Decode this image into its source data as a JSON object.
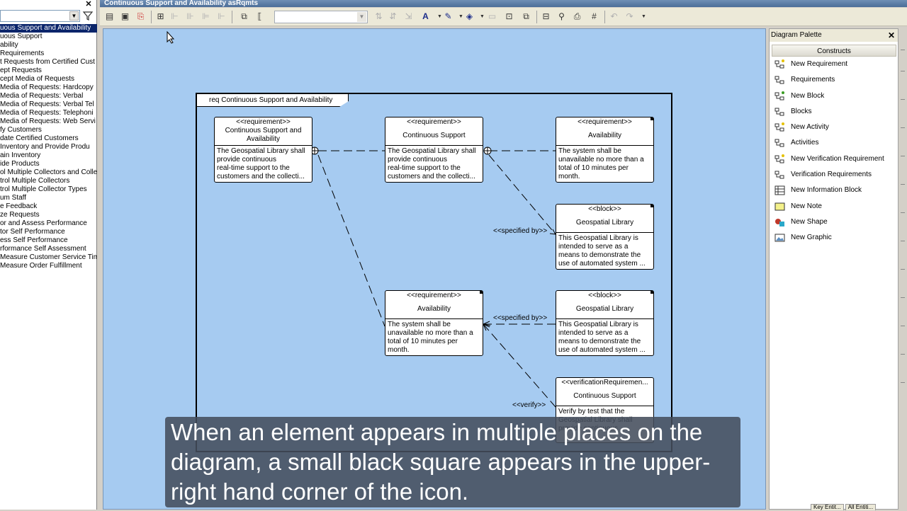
{
  "window": {
    "title": "Continuous Support and Availability asRqmts"
  },
  "tree": {
    "items": [
      "uous Support and Availability",
      "uous Support",
      "ability",
      "Requirements",
      "t Requests from Certified Cust",
      "ept Requests",
      "cept Media of Requests",
      "Media of Requests: Hardcopy",
      "Media of Requests: Verbal",
      "Media of Requests: Verbal Tel",
      "Media of Requests: Telephoni",
      "Media of Requests: Web Servi",
      "fy Customers",
      "date Certified Customers",
      " Inventory and Provide Produ",
      "ain Inventory",
      "ide Products",
      "ol Multiple Collectors and Collec",
      "trol Multiple Collectors",
      "trol Multiple Collector Types",
      "um Staff",
      "e Feedback",
      "ze Requests",
      "or and Assess Performance",
      "tor Self Performance",
      "ess Self Performance",
      "rformance Self Assessment",
      "Measure Customer Service Tim",
      "Measure Order Fulfillment"
    ]
  },
  "diagram": {
    "frame_label": "req Continuous Support and Availability",
    "nodes": {
      "req1": {
        "stereotype": "<<requirement>>",
        "name": "Continuous Support and\nAvailability",
        "text": "The Geospatial Library shall\nprovide continuous\nreal-time support to the\ncustomers and the collecti..."
      },
      "req2": {
        "stereotype": "<<requirement>>",
        "name": "Continuous Support",
        "text": "The Geospatial Library shall\nprovide continuous\nreal-time support to the\ncustomers and the collecti..."
      },
      "req3": {
        "stereotype": "<<requirement>>",
        "name": "Availability",
        "text": "The system shall be\nunavailable no more than a\ntotal of 10 minutes per\nmonth."
      },
      "block1": {
        "stereotype": "<<block>>",
        "name": "Geospatial Library",
        "text": "This Geospatial Library is\nintended to serve as a\nmeans to demonstrate the\nuse of automated system ..."
      },
      "req4": {
        "stereotype": "<<requirement>>",
        "name": "Availability",
        "text": "The system shall be\nunavailable no more than a\ntotal of 10 minutes per\nmonth."
      },
      "block2": {
        "stereotype": "<<block>>",
        "name": "Geospatial Library",
        "text": "This Geospatial Library is\nintended to serve as a\nmeans to demonstrate the\nuse of automated system ..."
      },
      "ver1": {
        "stereotype": "<<verificationRequiremen...",
        "name": "Continuous Support",
        "text": "Verify by test that the\nGeospatial Library shall\nprovide continuous"
      }
    },
    "edge_labels": {
      "specified_by_1": "<<specified by>>",
      "specified_by_2": "<<specified by>>",
      "verify": "<<verify>>"
    }
  },
  "palette": {
    "title": "Diagram Palette",
    "group": "Constructs",
    "items": [
      {
        "label": "New Requirement",
        "icon": "requirement-new-icon"
      },
      {
        "label": "Requirements",
        "icon": "requirement-icon"
      },
      {
        "label": "New Block",
        "icon": "block-new-icon"
      },
      {
        "label": "Blocks",
        "icon": "block-icon"
      },
      {
        "label": "New Activity",
        "icon": "activity-new-icon"
      },
      {
        "label": "Activities",
        "icon": "activity-icon"
      },
      {
        "label": "New Verification Requirement",
        "icon": "verification-new-icon"
      },
      {
        "label": "Verification Requirements",
        "icon": "verification-icon"
      },
      {
        "label": "New Information Block",
        "icon": "information-block-icon"
      },
      {
        "label": "New Note",
        "icon": "note-icon"
      },
      {
        "label": "New Shape",
        "icon": "shape-icon"
      },
      {
        "label": "New Graphic",
        "icon": "graphic-icon"
      }
    ],
    "bottom_tabs": [
      "Key Entit...",
      "All Entiti..."
    ]
  },
  "caption": {
    "text": "When an element appears in multiple places on the diagram, a small black square appears in the upper-right hand corner of the icon."
  },
  "colors": {
    "canvas": "#a6cbf1",
    "selection": "#0a246a",
    "caption_bg": "#444d5c"
  }
}
